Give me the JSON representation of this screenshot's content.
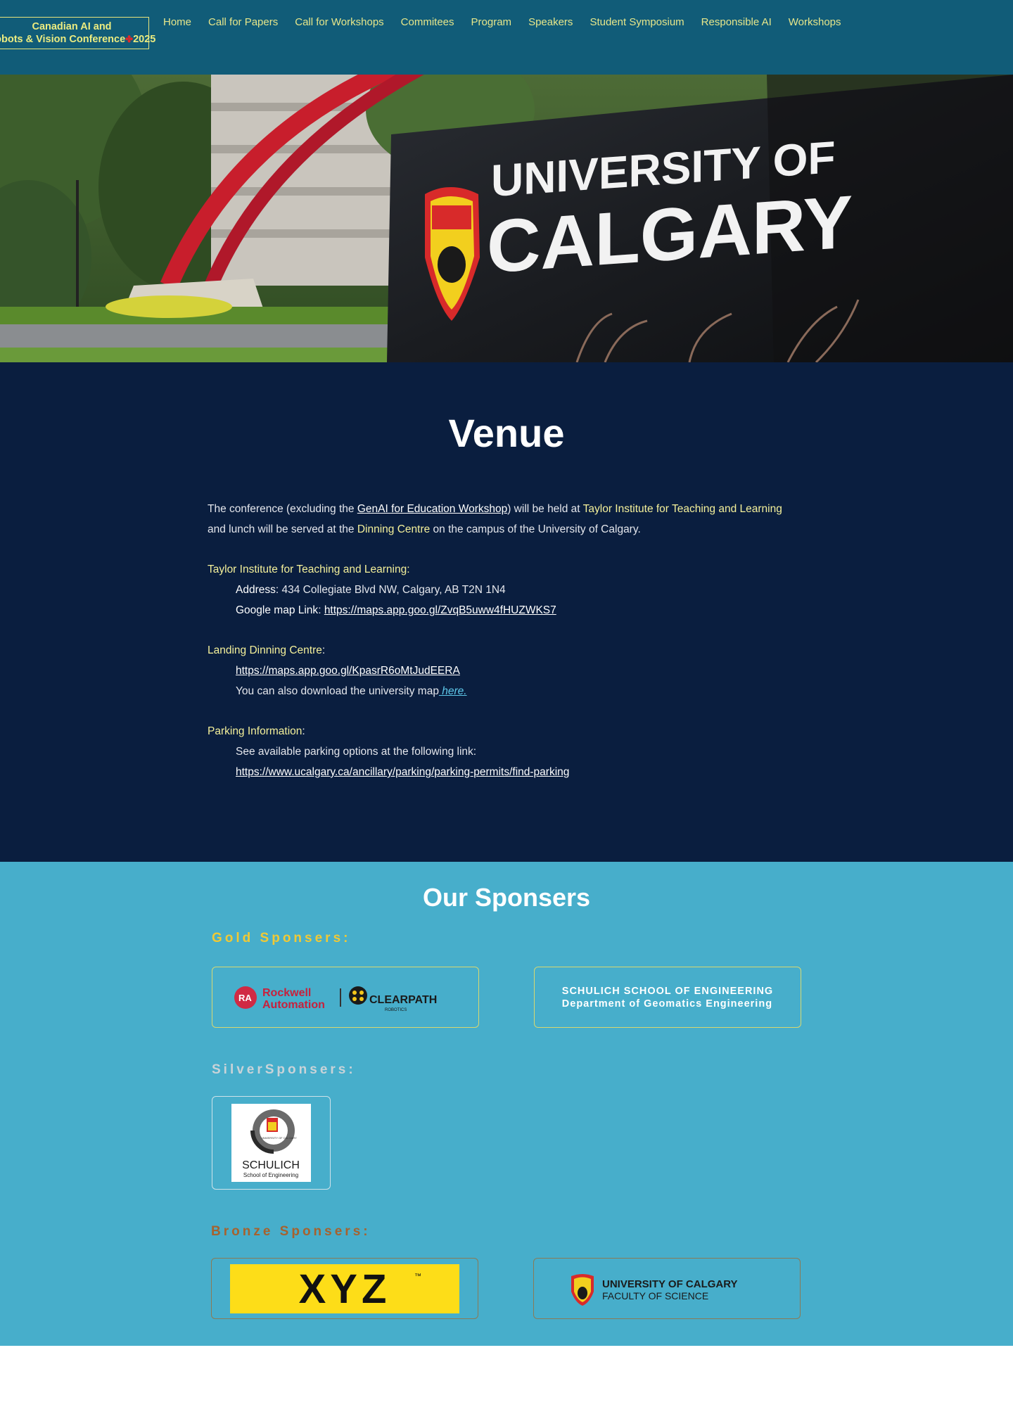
{
  "header": {
    "logo_line1": "Canadian AI and",
    "logo_line2_prefix": "Robots & Vision Conference",
    "logo_line2_suffix": "2025",
    "nav": [
      "Home",
      "Call for Papers",
      "Call for Workshops",
      "Commitees",
      "Program",
      "Speakers",
      "Student Symposium",
      "Responsible AI",
      "Workshops"
    ]
  },
  "hero": {
    "sign_line1": "UNIVERSITY OF",
    "sign_line2": "CALGARY"
  },
  "venue": {
    "title": "Venue",
    "intro_a": "The conference (excluding the ",
    "intro_link": "GenAI for Education Workshop",
    "intro_b": ") will be held at ",
    "intro_place": "Taylor Institute for Teaching and Learning",
    "intro_c": "and lunch will be served at the ",
    "intro_dining": "Dinning Centre",
    "intro_d": " on the campus of the University of Calgary.",
    "taylor_heading": "Taylor Institute for Teaching and Learning:",
    "address_label": "Address",
    "address_value": ": 434 Collegiate Blvd NW, Calgary, AB T2N 1N4",
    "gmap_label": "Google map Link",
    "gmap_sep": ": ",
    "gmap_url": "https://maps.app.goo.gl/ZvqB5uww4fHUZWKS7",
    "dining_heading": "Landing Dinning Centre",
    "dining_colon": ":",
    "dining_url": "https://maps.app.goo.gl/KpasrR6oMtJudEERA",
    "map_text": "You can also download the university map",
    "map_link": " here.",
    "parking_heading": "Parking Information",
    "parking_colon": ":",
    "parking_text": "See available parking options at the following link:",
    "parking_url": "https://www.ucalgary.ca/ancillary/parking/parking-permits/find-parking"
  },
  "sponsors": {
    "title": "Our Sponsers",
    "gold_label": "Gold Sponsers:",
    "silver_label": "SilverSponsers:",
    "bronze_label": "Bronze Sponsers:",
    "rockwell_line1": "Rockwell",
    "rockwell_line2": "Automation",
    "rockwell_badge": "RA",
    "clearpath_name": "CLEARPATH",
    "clearpath_sub": "ROBOTICS",
    "schulich_line1": "SCHULICH SCHOOL OF ENGINEERING",
    "schulich_line2": "Department of Geomatics Engineering",
    "schulich_logo_name": "SCHULICH",
    "schulich_logo_sub": "School of Engineering",
    "schulich_logo_crest": "UNIVERSITY OF CALGARY",
    "xyz_text": "XYZ",
    "xyz_tm": "™",
    "science_line1": "UNIVERSITY OF CALGARY",
    "science_line2": "FACULTY OF SCIENCE"
  }
}
